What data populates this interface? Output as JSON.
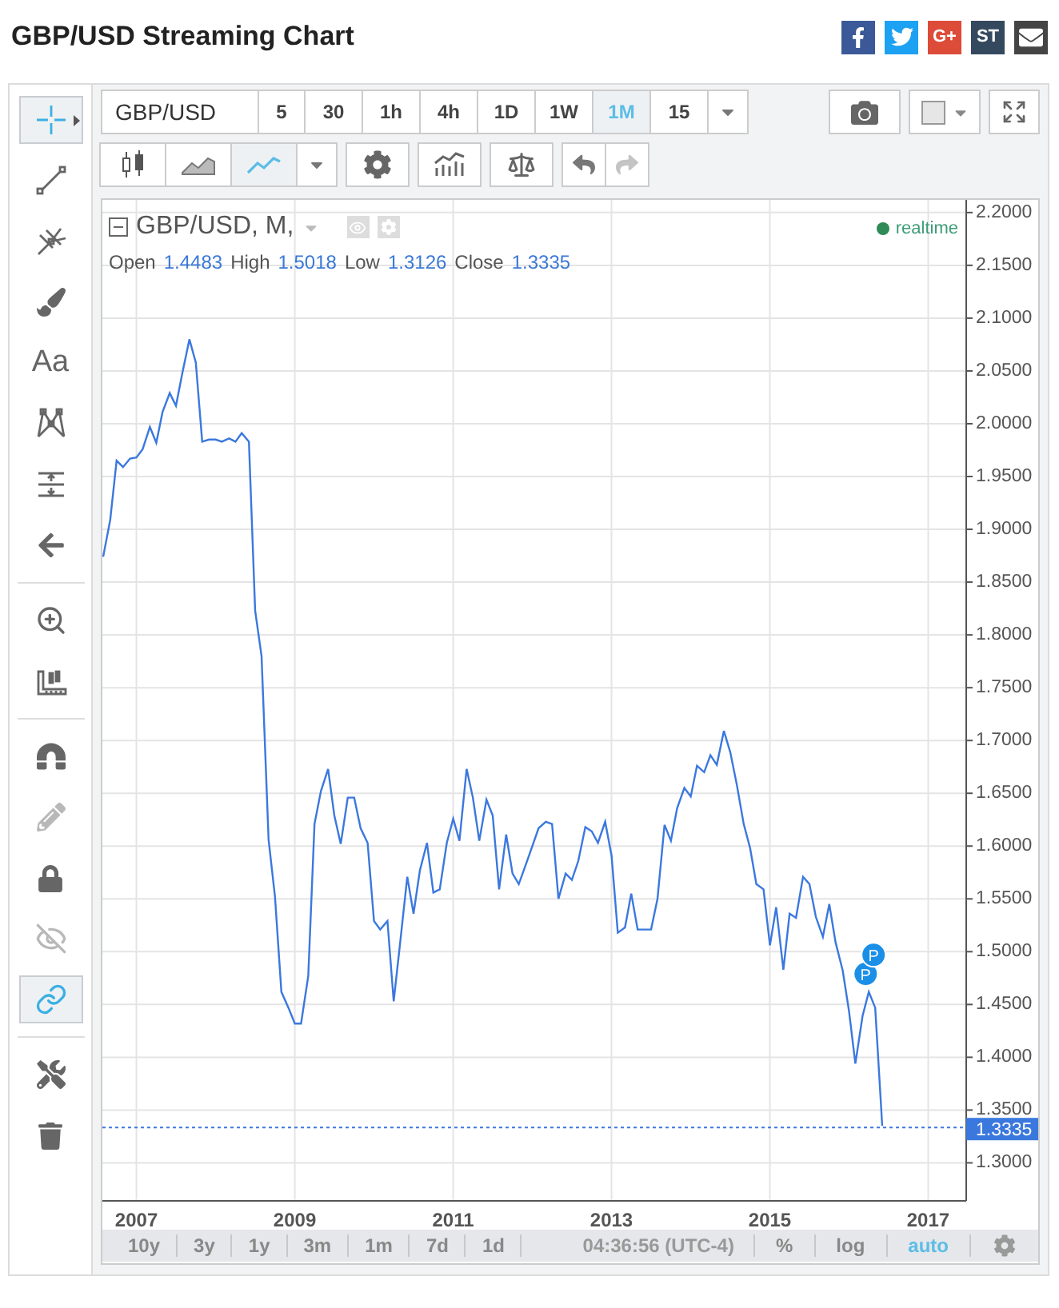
{
  "title": "GBP/USD Streaming Chart",
  "share_buttons": [
    {
      "kind": "facebook"
    },
    {
      "kind": "twitter"
    },
    {
      "kind": "googleplus",
      "label": "G+"
    },
    {
      "kind": "stocktwits",
      "label": "ST"
    },
    {
      "kind": "email"
    }
  ],
  "tool_groups": [
    [
      {
        "kind": "crosshair",
        "selected": true,
        "disabled": false
      },
      {
        "kind": "trendline",
        "selected": false,
        "disabled": false
      },
      {
        "kind": "pitchfork",
        "selected": false,
        "disabled": false
      },
      {
        "kind": "brush",
        "selected": false,
        "disabled": false
      },
      {
        "kind": "text",
        "label": "Aa",
        "selected": false,
        "disabled": false
      },
      {
        "kind": "pattern",
        "selected": false,
        "disabled": false
      },
      {
        "kind": "measure",
        "selected": false,
        "disabled": false
      },
      {
        "kind": "back",
        "selected": false,
        "disabled": false
      }
    ],
    [
      {
        "kind": "zoom",
        "selected": false,
        "disabled": false
      },
      {
        "kind": "ruler",
        "selected": false,
        "disabled": false
      }
    ],
    [
      {
        "kind": "magnet",
        "selected": false,
        "disabled": false
      },
      {
        "kind": "pencils",
        "selected": false,
        "disabled": true
      },
      {
        "kind": "lock",
        "selected": false,
        "disabled": false
      },
      {
        "kind": "hide",
        "selected": false,
        "disabled": true
      },
      {
        "kind": "link",
        "selected": true,
        "disabled": false
      }
    ],
    [
      {
        "kind": "tools",
        "selected": false,
        "disabled": false
      },
      {
        "kind": "trash",
        "selected": false,
        "disabled": false
      }
    ]
  ],
  "symbol": "GBP/USD",
  "intervals": [
    {
      "label": "5",
      "selected": false
    },
    {
      "label": "30",
      "selected": false
    },
    {
      "label": "1h",
      "selected": false
    },
    {
      "label": "4h",
      "selected": false
    },
    {
      "label": "1D",
      "selected": false
    },
    {
      "label": "1W",
      "selected": false
    },
    {
      "label": "1M",
      "selected": true
    },
    {
      "label": "15",
      "selected": false
    }
  ],
  "chart_types": [
    {
      "kind": "candles",
      "selected": false
    },
    {
      "kind": "area",
      "selected": false
    },
    {
      "kind": "line",
      "selected": true
    }
  ],
  "history": [
    {
      "kind": "undo",
      "disabled": false
    },
    {
      "kind": "redo",
      "disabled": true
    }
  ],
  "legend": {
    "symbol_label": "GBP/USD, M,",
    "ohlc": [
      {
        "label": "Open",
        "value": "1.4483"
      },
      {
        "label": "High",
        "value": "1.5018"
      },
      {
        "label": "Low",
        "value": "1.3126"
      },
      {
        "label": "Close",
        "value": "1.3335"
      }
    ],
    "status": "realtime"
  },
  "chart_data": {
    "type": "line",
    "x": [
      2006.58,
      2006.67,
      2006.75,
      2006.83,
      2006.92,
      2007,
      2007.08,
      2007.17,
      2007.25,
      2007.33,
      2007.42,
      2007.5,
      2007.58,
      2007.67,
      2007.75,
      2007.83,
      2007.92,
      2008,
      2008.08,
      2008.17,
      2008.25,
      2008.33,
      2008.42,
      2008.5,
      2008.58,
      2008.67,
      2008.75,
      2008.83,
      2008.92,
      2009,
      2009.08,
      2009.17,
      2009.25,
      2009.33,
      2009.42,
      2009.5,
      2009.58,
      2009.67,
      2009.75,
      2009.83,
      2009.92,
      2010,
      2010.08,
      2010.17,
      2010.25,
      2010.33,
      2010.42,
      2010.5,
      2010.58,
      2010.67,
      2010.75,
      2010.83,
      2010.92,
      2011,
      2011.08,
      2011.17,
      2011.25,
      2011.33,
      2011.42,
      2011.5,
      2011.58,
      2011.67,
      2011.75,
      2011.83,
      2011.92,
      2012,
      2012.08,
      2012.17,
      2012.25,
      2012.33,
      2012.42,
      2012.5,
      2012.58,
      2012.67,
      2012.75,
      2012.83,
      2012.92,
      2013,
      2013.08,
      2013.17,
      2013.25,
      2013.33,
      2013.42,
      2013.5,
      2013.58,
      2013.67,
      2013.75,
      2013.83,
      2013.92,
      2014,
      2014.08,
      2014.17,
      2014.25,
      2014.33,
      2014.42,
      2014.5,
      2014.58,
      2014.67,
      2014.75,
      2014.83,
      2014.92,
      2015,
      2015.08,
      2015.17,
      2015.25,
      2015.33,
      2015.42,
      2015.5,
      2015.58,
      2015.67,
      2015.75,
      2015.83,
      2015.92,
      2016,
      2016.08,
      2016.17,
      2016.25,
      2016.33,
      2016.42
    ],
    "series": [
      {
        "color": "#3b78de",
        "values": [
          1.874,
          1.909,
          1.965,
          1.959,
          1.967,
          1.968,
          1.976,
          1.997,
          1.982,
          2.011,
          2.029,
          2.017,
          2.048,
          2.08,
          2.058,
          1.983,
          1.985,
          1.985,
          1.983,
          1.986,
          1.983,
          1.991,
          1.983,
          1.823,
          1.78,
          1.606,
          1.552,
          1.462,
          1.447,
          1.432,
          1.432,
          1.477,
          1.621,
          1.652,
          1.673,
          1.629,
          1.602,
          1.646,
          1.646,
          1.617,
          1.603,
          1.529,
          1.521,
          1.529,
          1.453,
          1.508,
          1.571,
          1.536,
          1.577,
          1.603,
          1.556,
          1.559,
          1.603,
          1.626,
          1.605,
          1.673,
          1.646,
          1.605,
          1.644,
          1.629,
          1.559,
          1.611,
          1.574,
          1.564,
          1.583,
          1.6,
          1.617,
          1.623,
          1.621,
          1.55,
          1.574,
          1.568,
          1.586,
          1.618,
          1.614,
          1.603,
          1.623,
          1.591,
          1.518,
          1.523,
          1.555,
          1.521,
          1.521,
          1.521,
          1.55,
          1.62,
          1.605,
          1.636,
          1.655,
          1.647,
          1.676,
          1.67,
          1.686,
          1.677,
          1.709,
          1.689,
          1.659,
          1.621,
          1.598,
          1.564,
          1.559,
          1.506,
          1.542,
          1.483,
          1.536,
          1.532,
          1.571,
          1.564,
          1.533,
          1.514,
          1.545,
          1.509,
          1.482,
          1.444,
          1.394,
          1.439,
          1.462,
          1.447,
          1.335
        ]
      }
    ],
    "xlim": [
      2006.57,
      2017.48
    ],
    "ylim": [
      1.264,
      2.212
    ],
    "grid": true,
    "xticks": [
      2007,
      2009,
      2011,
      2013,
      2015,
      2017
    ],
    "yticks": [
      {
        "value": 1.3,
        "label": "1.3000"
      },
      {
        "value": 1.35,
        "label": "1.3500"
      },
      {
        "value": 1.4,
        "label": "1.4000"
      },
      {
        "value": 1.45,
        "label": "1.4500"
      },
      {
        "value": 1.5,
        "label": "1.5000"
      },
      {
        "value": 1.55,
        "label": "1.5500"
      },
      {
        "value": 1.6,
        "label": "1.6000"
      },
      {
        "value": 1.65,
        "label": "1.6500"
      },
      {
        "value": 1.7,
        "label": "1.7000"
      },
      {
        "value": 1.75,
        "label": "1.7500"
      },
      {
        "value": 1.8,
        "label": "1.8000"
      },
      {
        "value": 1.85,
        "label": "1.8500"
      },
      {
        "value": 1.9,
        "label": "1.9000"
      },
      {
        "value": 1.95,
        "label": "1.9500"
      },
      {
        "value": 2.0,
        "label": "2.0000"
      },
      {
        "value": 2.05,
        "label": "2.0500"
      },
      {
        "value": 2.1,
        "label": "2.1000"
      },
      {
        "value": 2.15,
        "label": "2.1500"
      },
      {
        "value": 2.2,
        "label": "2.2000"
      }
    ],
    "ref_lines": [
      {
        "axis": "y",
        "value": 1.3335,
        "label": "1.3335"
      }
    ],
    "annotations": [
      {
        "text": "P",
        "x": 2016.21,
        "y": 1.479
      },
      {
        "text": "P",
        "x": 2016.31,
        "y": 1.497
      }
    ]
  },
  "ranges": [
    {
      "label": "10y",
      "selected": false
    },
    {
      "label": "3y",
      "selected": false
    },
    {
      "label": "1y",
      "selected": false
    },
    {
      "label": "3m",
      "selected": false
    },
    {
      "label": "1m",
      "selected": false
    },
    {
      "label": "7d",
      "selected": false
    },
    {
      "label": "1d",
      "selected": false
    }
  ],
  "clock": "04:36:56 (UTC-4)",
  "scale_modes": [
    {
      "label": "%",
      "selected": false
    },
    {
      "label": "log",
      "selected": false
    },
    {
      "label": "auto",
      "selected": true
    }
  ]
}
